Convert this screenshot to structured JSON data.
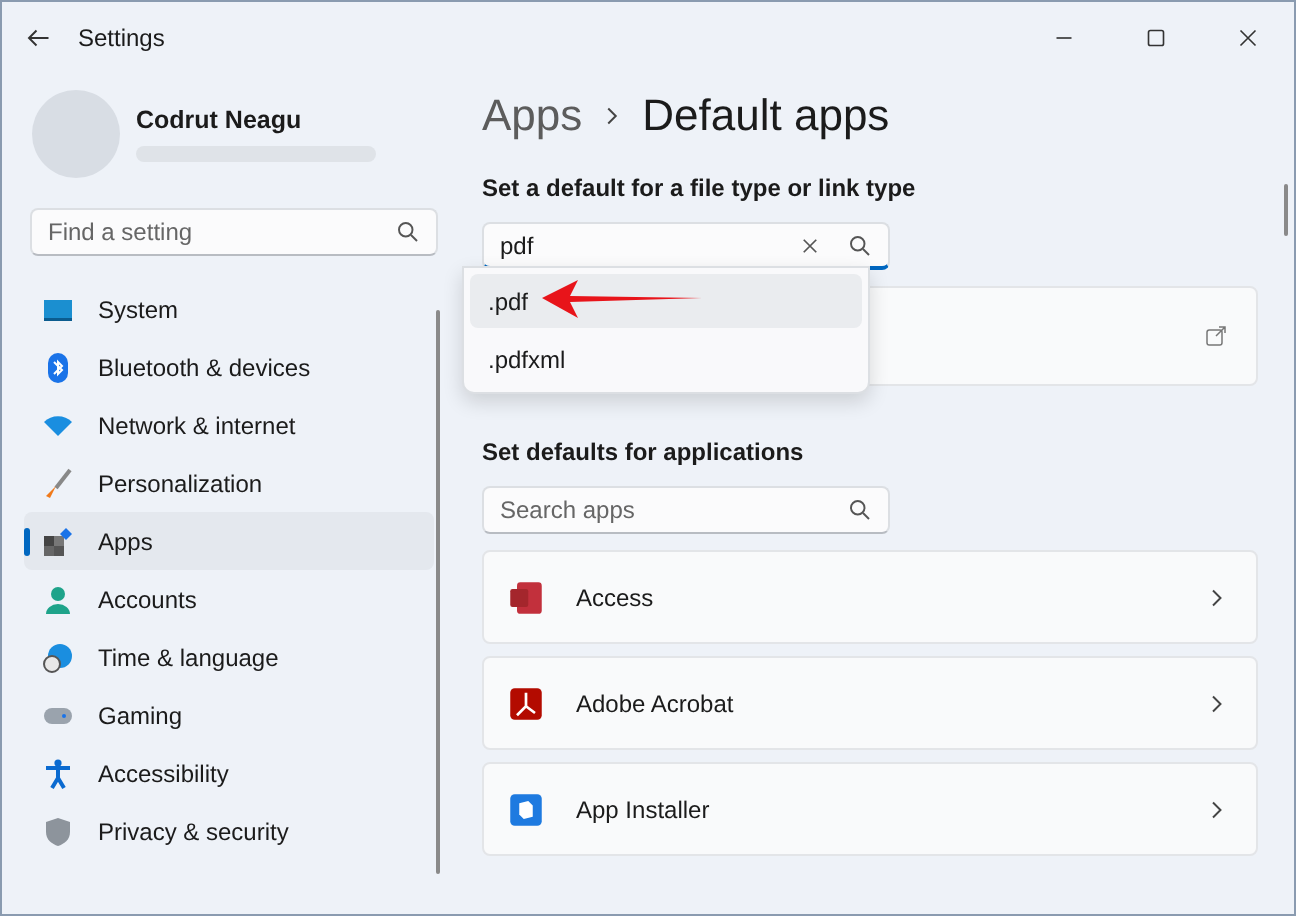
{
  "window": {
    "title": "Settings"
  },
  "profile": {
    "name": "Codrut Neagu"
  },
  "sidebar": {
    "search": {
      "placeholder": "Find a setting"
    },
    "items": [
      {
        "label": "System",
        "selected": false
      },
      {
        "label": "Bluetooth & devices",
        "selected": false
      },
      {
        "label": "Network & internet",
        "selected": false
      },
      {
        "label": "Personalization",
        "selected": false
      },
      {
        "label": "Apps",
        "selected": true
      },
      {
        "label": "Accounts",
        "selected": false
      },
      {
        "label": "Time & language",
        "selected": false
      },
      {
        "label": "Gaming",
        "selected": false
      },
      {
        "label": "Accessibility",
        "selected": false
      },
      {
        "label": "Privacy & security",
        "selected": false
      }
    ]
  },
  "breadcrumb": {
    "parent": "Apps",
    "current": "Default apps"
  },
  "file_type_section": {
    "heading": "Set a default for a file type or link type",
    "search": {
      "value": "pdf"
    },
    "suggestions": [
      {
        "label": ".pdf",
        "selected": true
      },
      {
        "label": ".pdfxml",
        "selected": false
      }
    ]
  },
  "apps_section": {
    "heading": "Set defaults for applications",
    "search": {
      "placeholder": "Search apps"
    },
    "apps": [
      {
        "name": "Access"
      },
      {
        "name": "Adobe Acrobat"
      },
      {
        "name": "App Installer"
      }
    ]
  }
}
